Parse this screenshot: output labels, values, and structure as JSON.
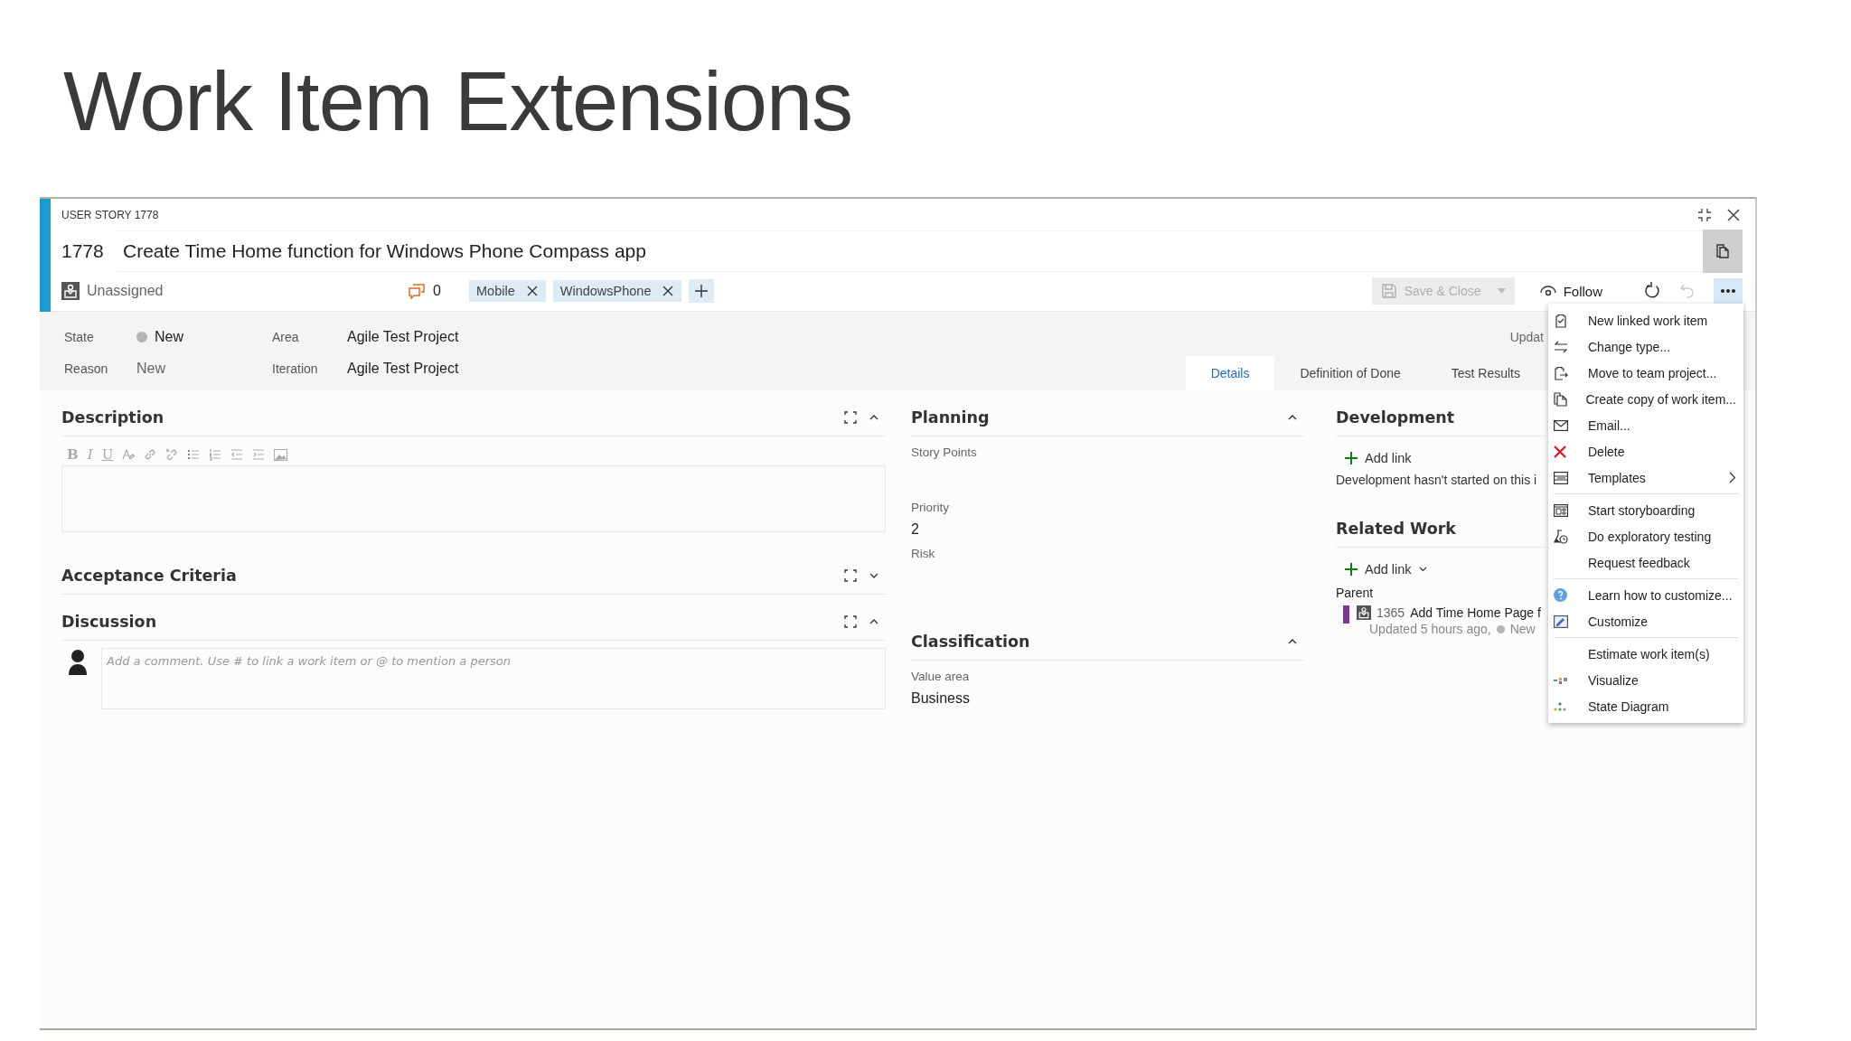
{
  "slide_title": "Work Item Extensions",
  "work_item": {
    "type_label": "USER STORY 1778",
    "id": "1778",
    "title": "Create Time Home function for Windows Phone Compass app",
    "assigned_to": "Unassigned",
    "comment_count": "0",
    "tags": [
      "Mobile",
      "WindowsPhone"
    ],
    "save_close": {
      "label": "Save & Close",
      "disabled": true
    },
    "follow": "Follow",
    "undo_disabled": true,
    "more_expanded": true,
    "fields": [
      {
        "label": "State",
        "value": "New",
        "color": "#b4b4b4"
      },
      {
        "label": "Area",
        "value": "Agile Test Project"
      },
      {
        "label": "Reason",
        "value": "New"
      },
      {
        "label": "Iteration",
        "value": "Agile Test Project"
      }
    ],
    "updated_text": "Updat",
    "tabs": [
      {
        "label": "Details",
        "selected": true
      },
      {
        "label": "Definition of Done",
        "selected": false
      },
      {
        "label": "Test Results",
        "selected": false
      }
    ]
  },
  "description": {
    "title": "Description",
    "expanded": true,
    "format_buttons": [
      "B",
      "I",
      "U"
    ]
  },
  "acceptance": {
    "title": "Acceptance Criteria",
    "expanded": false
  },
  "discussion": {
    "title": "Discussion",
    "expanded": true,
    "placeholder": "Add a comment. Use # to link a work item or @ to mention a person"
  },
  "planning": {
    "title": "Planning",
    "expanded": true,
    "fields": [
      {
        "label": "Story Points"
      },
      {
        "label": "Priority",
        "value": "2"
      },
      {
        "label": "Risk"
      }
    ]
  },
  "classification": {
    "title": "Classification",
    "expanded": true,
    "fields": [
      {
        "label": "Value area",
        "value": "Business"
      }
    ]
  },
  "development": {
    "title": "Development",
    "add_link": "Add link",
    "note": "Development hasn't started on this i"
  },
  "related_work": {
    "title": "Related Work",
    "add_link": "Add link",
    "parent_label": "Parent",
    "parent": {
      "id": "1365",
      "title": "Add Time Home Page f",
      "color": "#773b93",
      "updated": "Updated 5 hours ago,",
      "state": "New"
    }
  },
  "menu": [
    {
      "kind": "item",
      "label": "New linked work item"
    },
    {
      "kind": "item",
      "label": "Change type..."
    },
    {
      "kind": "item",
      "label": "Move to team project..."
    },
    {
      "kind": "item",
      "label": "Create copy of work item..."
    },
    {
      "kind": "item",
      "label": "Email..."
    },
    {
      "kind": "item",
      "label": "Delete"
    },
    {
      "kind": "item",
      "label": "Templates",
      "submenu": true
    },
    {
      "kind": "separator"
    },
    {
      "kind": "item",
      "label": "Start storyboarding"
    },
    {
      "kind": "item",
      "label": "Do exploratory testing"
    },
    {
      "kind": "item",
      "label": "Request feedback"
    },
    {
      "kind": "separator"
    },
    {
      "kind": "item",
      "label": "Learn how to customize..."
    },
    {
      "kind": "item",
      "label": "Customize"
    },
    {
      "kind": "separator"
    },
    {
      "kind": "item",
      "label": "Estimate work item(s)"
    },
    {
      "kind": "item",
      "label": "Visualize"
    },
    {
      "kind": "item",
      "label": "State Diagram"
    }
  ]
}
